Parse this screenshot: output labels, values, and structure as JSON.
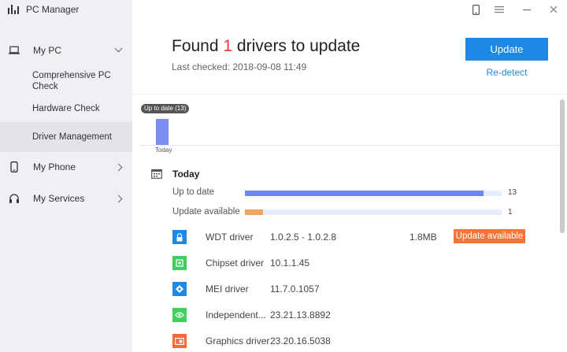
{
  "app": {
    "title": "PC Manager"
  },
  "sidebar": {
    "items": [
      {
        "label": "My PC",
        "icon": "laptop-icon"
      },
      {
        "label": "My Phone",
        "icon": "phone-icon"
      },
      {
        "label": "My Services",
        "icon": "headset-icon"
      }
    ],
    "subitems": [
      {
        "label": "Comprehensive PC Check"
      },
      {
        "label": "Hardware Check"
      },
      {
        "label": "Driver Management"
      }
    ]
  },
  "header": {
    "found_prefix": "Found",
    "found_count": "1",
    "found_suffix": "drivers to update",
    "last_checked": "Last checked: 2018-09-08 11:49",
    "update_label": "Update",
    "redetect_label": "Re-detect"
  },
  "timeline": {
    "bubble": "Up to date (13)",
    "date_label": "Today"
  },
  "today": {
    "title": "Today",
    "stats": [
      {
        "label": "Up to date",
        "count": "13",
        "fraction": 0.93,
        "color": "#6f86f0"
      },
      {
        "label": "Update available",
        "count": "1",
        "fraction": 0.07,
        "color": "#f4a15d"
      }
    ]
  },
  "drivers": [
    {
      "name": "WDT driver",
      "version": "1.0.2.5 - 1.0.2.8",
      "size": "1.8MB",
      "badge": "Update available",
      "icon": "lock-icon",
      "color": "#1e88e5"
    },
    {
      "name": "Chipset driver",
      "version": "10.1.1.45",
      "size": "",
      "badge": "",
      "icon": "chip-icon",
      "color": "#3ecf5e"
    },
    {
      "name": "MEI driver",
      "version": "11.7.0.1057",
      "size": "",
      "badge": "",
      "icon": "diamond-icon",
      "color": "#1e88e5"
    },
    {
      "name": "Independent...",
      "version": "23.21.13.8892",
      "size": "",
      "badge": "",
      "icon": "nvidia-icon",
      "color": "#3ecf5e"
    },
    {
      "name": "Graphics driver",
      "version": "23.20.16.5038",
      "size": "",
      "badge": "",
      "icon": "graphics-card-icon",
      "color": "#f26a3d"
    }
  ],
  "colors": {
    "accent": "#1e88e5",
    "warning": "#f4753a",
    "highlight": "#e53935"
  }
}
